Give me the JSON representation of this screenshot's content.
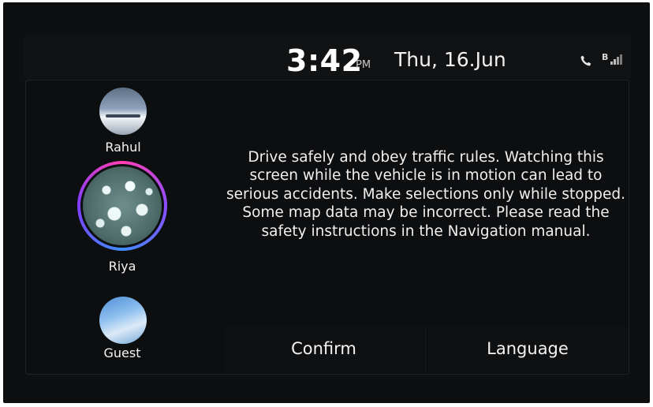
{
  "status_bar": {
    "time": "3:42",
    "ampm": "PM",
    "date": "Thu, 16.Jun",
    "icons": [
      "phone-icon",
      "bluetooth-signal-icon"
    ],
    "bt_label": "B"
  },
  "profiles": [
    {
      "name": "Rahul",
      "selected": false
    },
    {
      "name": "Riya",
      "selected": true
    },
    {
      "name": "Guest",
      "selected": false
    }
  ],
  "message": "Drive safely and obey traffic rules. Watching this screen while the vehicle is in motion can lead to serious accidents. Make selections only while stopped. Some map data may be incorrect. Please read the safety instructions in the Navigation manual.",
  "buttons": {
    "confirm": "Confirm",
    "language": "Language"
  },
  "colors": {
    "background": "#0e0f11",
    "text": "#f0f0f0",
    "selection_ring": "#8b4dff"
  }
}
